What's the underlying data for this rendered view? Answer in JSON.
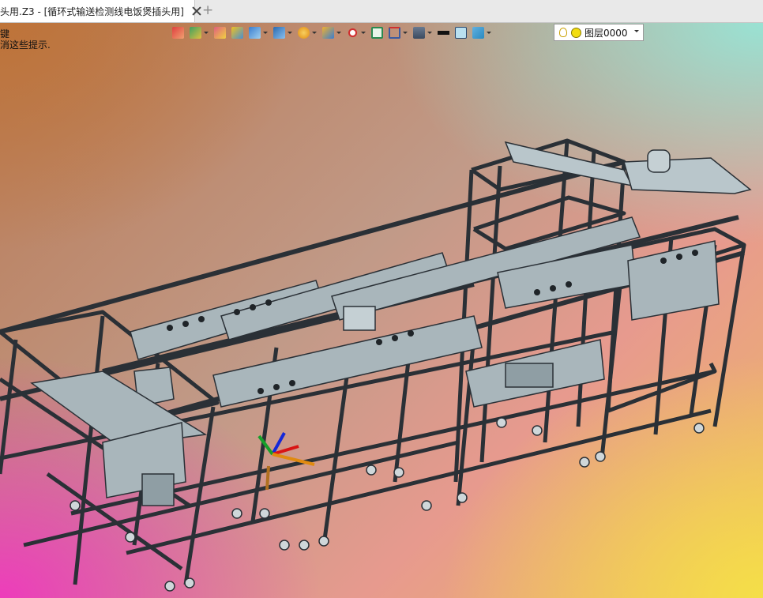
{
  "tab": {
    "title": "头用.Z3 - [循环式输送检测线电饭煲插头用]"
  },
  "viewport": {
    "hint_line1": "键",
    "hint_line2": "消这些提示."
  },
  "toolbar": {
    "icons": [
      "move-icon",
      "paint-icon",
      "edit-icon",
      "box-solid-icon",
      "cube-icon",
      "view-cube-icon",
      "render-icon",
      "zoom-window-icon",
      "axis-icon",
      "frame-icon",
      "dimension-icon",
      "display-icon",
      "line-weight-icon",
      "color-swatch-icon",
      "layer-stack-icon"
    ]
  },
  "layer": {
    "name": "图层0000"
  },
  "colors": {
    "tab_bg": "#e9e9e9",
    "frame": "#2a3036",
    "panel": "#a9b6bb"
  }
}
